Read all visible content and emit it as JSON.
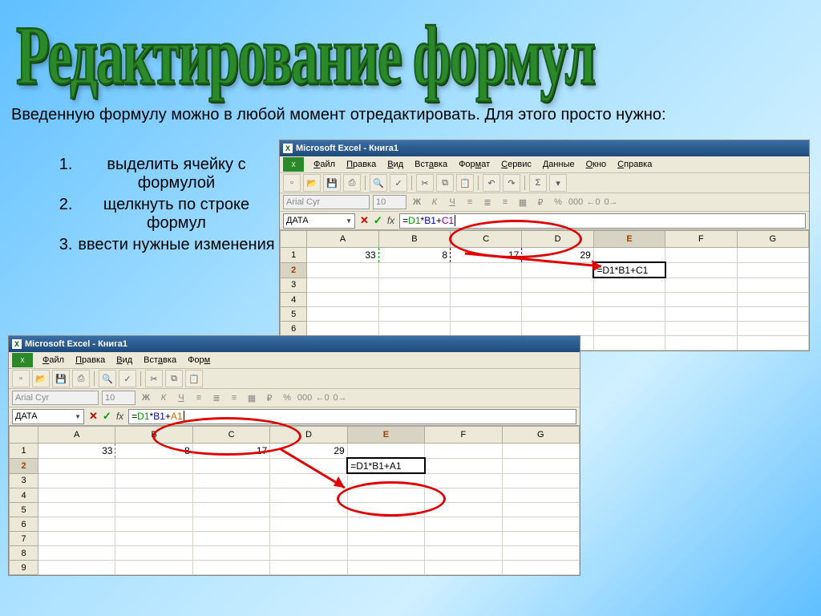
{
  "title": "Редактирование формул",
  "intro": "Введенную формулу можно в любой момент отредактировать. Для этого просто нужно:",
  "steps": [
    "выделить ячейку с формулой",
    "щелкнуть по строке формул",
    "ввести нужные изменения"
  ],
  "win_title": "Microsoft Excel - Книга1",
  "menu": [
    "Файл",
    "Правка",
    "Вид",
    "Вставка",
    "Формат",
    "Сервис",
    "Данные",
    "Окно",
    "Справка"
  ],
  "menu_short": [
    "Файл",
    "Правка",
    "Вид",
    "Вставка",
    "Форм"
  ],
  "font": "Arial Cyr",
  "size": "10",
  "namebox": "ДАТА",
  "w1": {
    "formula": "=D1*B1+C1",
    "display": "=D1*B1+C1",
    "cols": [
      "A",
      "B",
      "C",
      "D",
      "E",
      "F",
      "G"
    ],
    "row1": [
      "33",
      "8",
      "17",
      "29",
      "",
      ""
    ],
    "active_col": 4
  },
  "w2": {
    "formula": "=D1*B1+A1",
    "display": "=D1*B1+A1",
    "cols": [
      "A",
      "B",
      "C",
      "D",
      "E",
      "F",
      "G"
    ],
    "row1": [
      "33",
      "8",
      "17",
      "29",
      "",
      ""
    ],
    "active_col": 4
  },
  "fmt_labels": {
    "bold": "Ж",
    "italic": "К",
    "underline": "Ч",
    "currency": "%"
  },
  "sigma": "Σ"
}
